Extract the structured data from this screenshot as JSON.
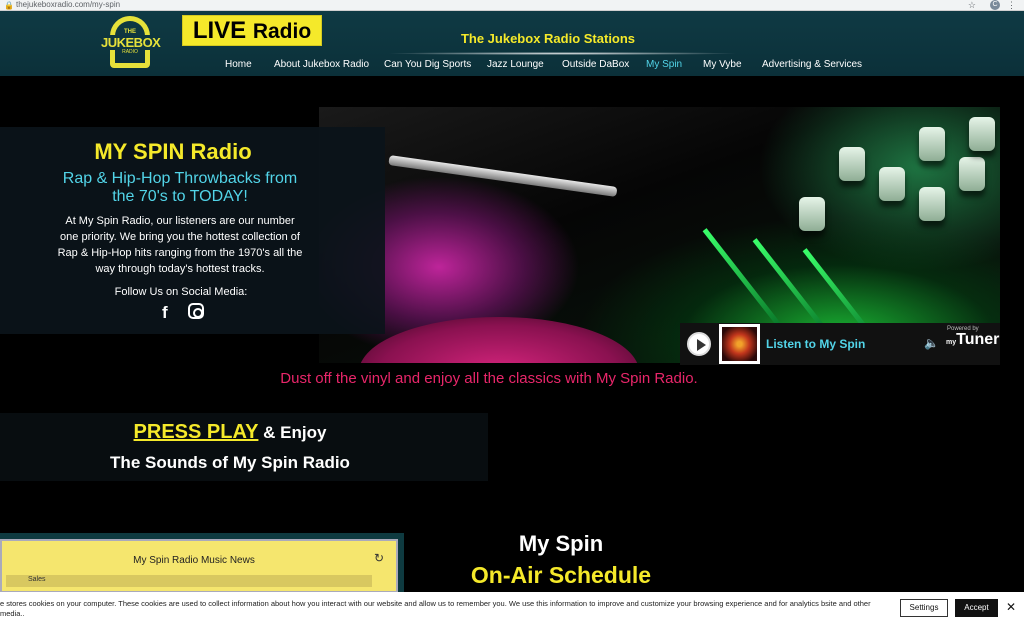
{
  "browser": {
    "url": "thejukeboxradio.com/my-spin",
    "profile_initial": "C"
  },
  "header": {
    "logo": {
      "the": "THE",
      "word": "JUKEBOX",
      "radio": "RADIO"
    },
    "live_badge": {
      "big": "LIVE",
      "small": "Radio"
    },
    "stations_title": "The Jukebox Radio Stations",
    "nav": [
      {
        "label": "Home"
      },
      {
        "label": "About Jukebox Radio"
      },
      {
        "label": "Can You Dig Sports"
      },
      {
        "label": "Jazz Lounge"
      },
      {
        "label": "Outside DaBox"
      },
      {
        "label": "My Spin",
        "active": true
      },
      {
        "label": "My Vybe"
      },
      {
        "label": "Advertising & Services"
      }
    ]
  },
  "intro": {
    "title": "MY SPIN Radio",
    "subtitle": "Rap & Hip-Hop Throwbacks from the 70's to TODAY!",
    "description": "At My Spin Radio, our listeners are our number one priority. We bring you the hottest collection of Rap & Hip-Hop hits ranging from the 1970's all the way through today's hottest tracks.",
    "follow_label": "Follow Us on Social Media:",
    "social_icons": [
      "facebook-icon",
      "instagram-icon"
    ]
  },
  "player": {
    "listen_label": "Listen to My Spin",
    "powered_by": "Powered by",
    "brand": "Tuner",
    "brand_prefix": "my"
  },
  "tagline": "Dust off the vinyl and enjoy all the classics with My Spin Radio.",
  "press": {
    "press_play": "PRESS PLAY",
    "enjoy": " & Enjoy",
    "line2": "The Sounds of My Spin Radio"
  },
  "news_widget": {
    "title": "My Spin Radio Music News",
    "row_label": "Sales"
  },
  "schedule": {
    "line1": "My Spin",
    "line2": "On-Air Schedule"
  },
  "cookie_banner": {
    "text": "e stores cookies on your computer. These cookies are used to collect information about how you interact with our website and allow us to remember you. We use this information to improve and customize your browsing experience and for analytics bsite and other media..",
    "settings_label": "Settings",
    "accept_label": "Accept",
    "close_glyph": "✕"
  },
  "colors": {
    "accent_yellow": "#f5e92a",
    "accent_cyan": "#52d4e8",
    "tagline_pink": "#e8266a",
    "header_bg": "#0f3a44"
  }
}
